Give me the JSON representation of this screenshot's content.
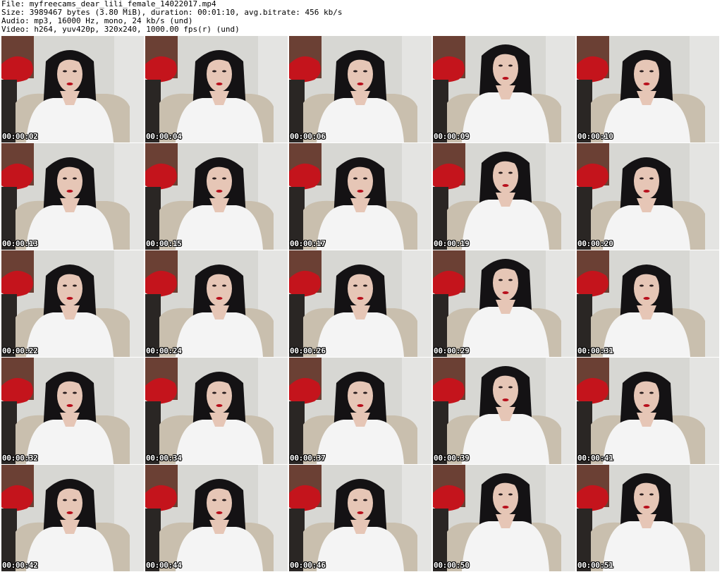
{
  "header": {
    "file": "File: myfreecams_dear_lili_female_14022017.mp4",
    "size": "Size: 3989467 bytes (3.80 MiB), duration: 00:01:10, avg.bitrate: 456 kb/s",
    "audio": "Audio: mp3, 16000 Hz, mono, 24 kb/s (und)",
    "video": "Video: h264, yuv420p, 320x240, 1000.00 fps(r) (und)"
  },
  "thumbnails": [
    {
      "timestamp": "00:00:02"
    },
    {
      "timestamp": "00:00:04"
    },
    {
      "timestamp": "00:00:06"
    },
    {
      "timestamp": "00:00:09"
    },
    {
      "timestamp": "00:00:10"
    },
    {
      "timestamp": "00:00:13"
    },
    {
      "timestamp": "00:00:15"
    },
    {
      "timestamp": "00:00:17"
    },
    {
      "timestamp": "00:00:19"
    },
    {
      "timestamp": "00:00:20"
    },
    {
      "timestamp": "00:00:22"
    },
    {
      "timestamp": "00:00:24"
    },
    {
      "timestamp": "00:00:26"
    },
    {
      "timestamp": "00:00:29"
    },
    {
      "timestamp": "00:00:31"
    },
    {
      "timestamp": "00:00:32"
    },
    {
      "timestamp": "00:00:34"
    },
    {
      "timestamp": "00:00:37"
    },
    {
      "timestamp": "00:00:39"
    },
    {
      "timestamp": "00:00:41"
    },
    {
      "timestamp": "00:00:42"
    },
    {
      "timestamp": "00:00:44"
    },
    {
      "timestamp": "00:00:46"
    },
    {
      "timestamp": "00:00:50"
    },
    {
      "timestamp": "00:00:51"
    }
  ],
  "colors": {
    "wall": "#d7d7d3",
    "hair": "#141214",
    "skin": "#e6c6b6",
    "blouse": "#f4f4f4",
    "red_cloth": "#c4141c",
    "brick": "#6b4034",
    "cushion": "#c9bfae"
  }
}
